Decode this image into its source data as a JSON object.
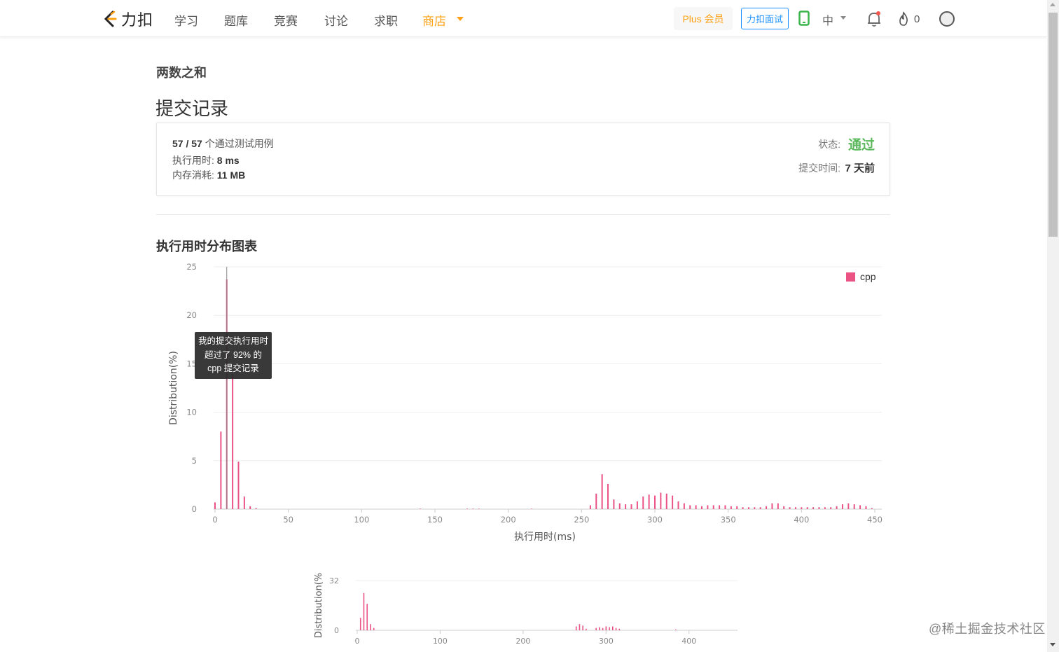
{
  "nav": {
    "logo_text": "力扣",
    "items": [
      "学习",
      "题库",
      "竞赛",
      "讨论",
      "求职",
      "商店"
    ],
    "plus_label": "Plus 会员",
    "interview_label": "力扣面试",
    "language": "中",
    "coins": "0"
  },
  "problem_title": "两数之和",
  "page_title": "提交记录",
  "summary": {
    "cases_passed": "57 / 57",
    "cases_label": "个通过测试用例",
    "runtime_label": "执行用时:",
    "runtime_value": "8 ms",
    "memory_label": "内存消耗:",
    "memory_value": "11 MB",
    "status_label": "状态:",
    "status_value": "通过",
    "submit_time_label": "提交时间:",
    "submit_time_value": "7 天前"
  },
  "chart_heading": "执行用时分布图表",
  "tooltip": {
    "line1": "我的提交执行用时",
    "line2": "超过了 92% 的",
    "line3": "cpp 提交记录"
  },
  "watermark": "@稀土掘金技术社区",
  "colors": {
    "accent": "#ffa116",
    "bar": "#ea5384",
    "pass": "#5cb85c",
    "interview": "#1a90ff"
  },
  "chart_data": [
    {
      "type": "bar",
      "ylabel": "Distribution(%)",
      "xlabel": "执行用时(ms)",
      "xlim": [
        0,
        450
      ],
      "ylim": [
        0,
        25
      ],
      "x_ticks": [
        0,
        50,
        100,
        150,
        200,
        250,
        300,
        350,
        400,
        450
      ],
      "y_ticks": [
        0,
        5,
        10,
        15,
        20,
        25
      ],
      "legend": [
        "cpp"
      ],
      "legend_position": "top-right",
      "my_submission_ms": 8,
      "series": [
        {
          "name": "cpp",
          "x": [
            0,
            4,
            8,
            12,
            16,
            20,
            24,
            28,
            140,
            172,
            176,
            180,
            216,
            256,
            260,
            264,
            268,
            272,
            276,
            280,
            284,
            288,
            292,
            296,
            300,
            304,
            308,
            312,
            316,
            320,
            324,
            328,
            332,
            336,
            340,
            344,
            348,
            352,
            356,
            360,
            364,
            368,
            372,
            376,
            380,
            384,
            388,
            392,
            396,
            400,
            404,
            408,
            412,
            416,
            420,
            424,
            428,
            432,
            436,
            440,
            444,
            448
          ],
          "values": [
            0.7,
            8.0,
            23.7,
            13.9,
            4.9,
            1.3,
            0.3,
            0.1,
            0.05,
            0.05,
            0.05,
            0.05,
            0.05,
            0.4,
            1.6,
            3.6,
            2.6,
            1.0,
            0.6,
            0.5,
            0.5,
            0.8,
            1.3,
            1.5,
            1.4,
            1.7,
            1.6,
            1.4,
            0.8,
            0.6,
            0.4,
            0.4,
            0.3,
            0.4,
            0.4,
            0.4,
            0.4,
            0.3,
            0.3,
            0.2,
            0.2,
            0.2,
            0.2,
            0.3,
            0.6,
            0.6,
            0.3,
            0.2,
            0.2,
            0.2,
            0.2,
            0.2,
            0.2,
            0.2,
            0.2,
            0.3,
            0.5,
            0.6,
            0.5,
            0.4,
            0.3,
            0.1
          ]
        }
      ]
    },
    {
      "type": "bar",
      "ylabel": "Distribution(%",
      "xlim": [
        0,
        450
      ],
      "ylim": [
        0,
        32
      ],
      "x_ticks": [
        0,
        100,
        200,
        300,
        400
      ],
      "y_ticks": [
        0,
        32
      ],
      "series": [
        {
          "x": [
            4,
            8,
            12,
            16,
            20,
            264,
            268,
            272,
            276,
            288,
            292,
            296,
            300,
            304,
            308,
            312,
            316,
            384
          ],
          "values": [
            8,
            24,
            17,
            4,
            1.5,
            2.5,
            4,
            3,
            1,
            1.5,
            2,
            1.5,
            2.5,
            2,
            2.5,
            1.5,
            1,
            0.5
          ]
        }
      ]
    }
  ]
}
